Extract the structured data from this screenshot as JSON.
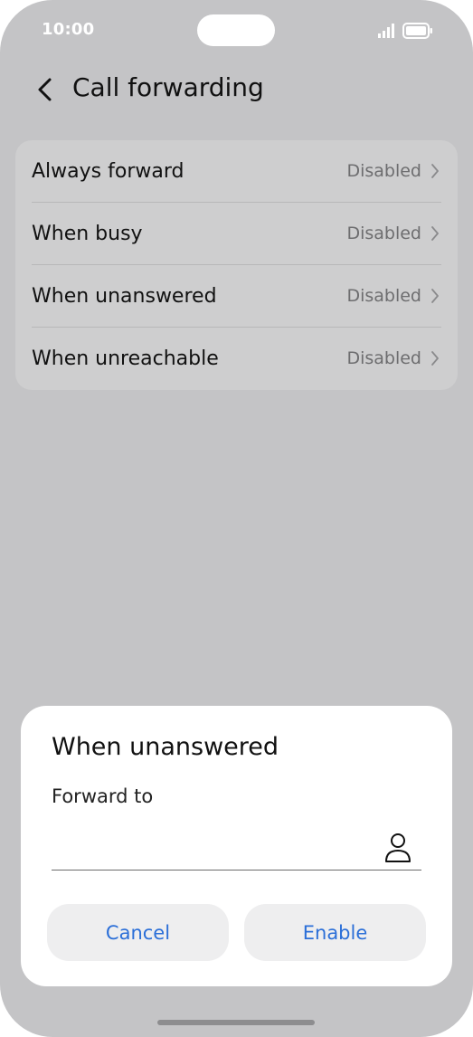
{
  "status_bar": {
    "time": "10:00"
  },
  "header": {
    "title": "Call forwarding",
    "back_icon": "chevron-left-icon"
  },
  "options": [
    {
      "label": "Always forward",
      "value": "Disabled"
    },
    {
      "label": "When busy",
      "value": "Disabled"
    },
    {
      "label": "When unanswered",
      "value": "Disabled"
    },
    {
      "label": "When unreachable",
      "value": "Disabled"
    }
  ],
  "dialog": {
    "title": "When unanswered",
    "field_label": "Forward to",
    "field_value": "",
    "contact_icon": "person-icon",
    "cancel_label": "Cancel",
    "enable_label": "Enable"
  },
  "colors": {
    "accent": "#2b6fd8",
    "background": "#c4c4c6",
    "card": "#cececf"
  }
}
